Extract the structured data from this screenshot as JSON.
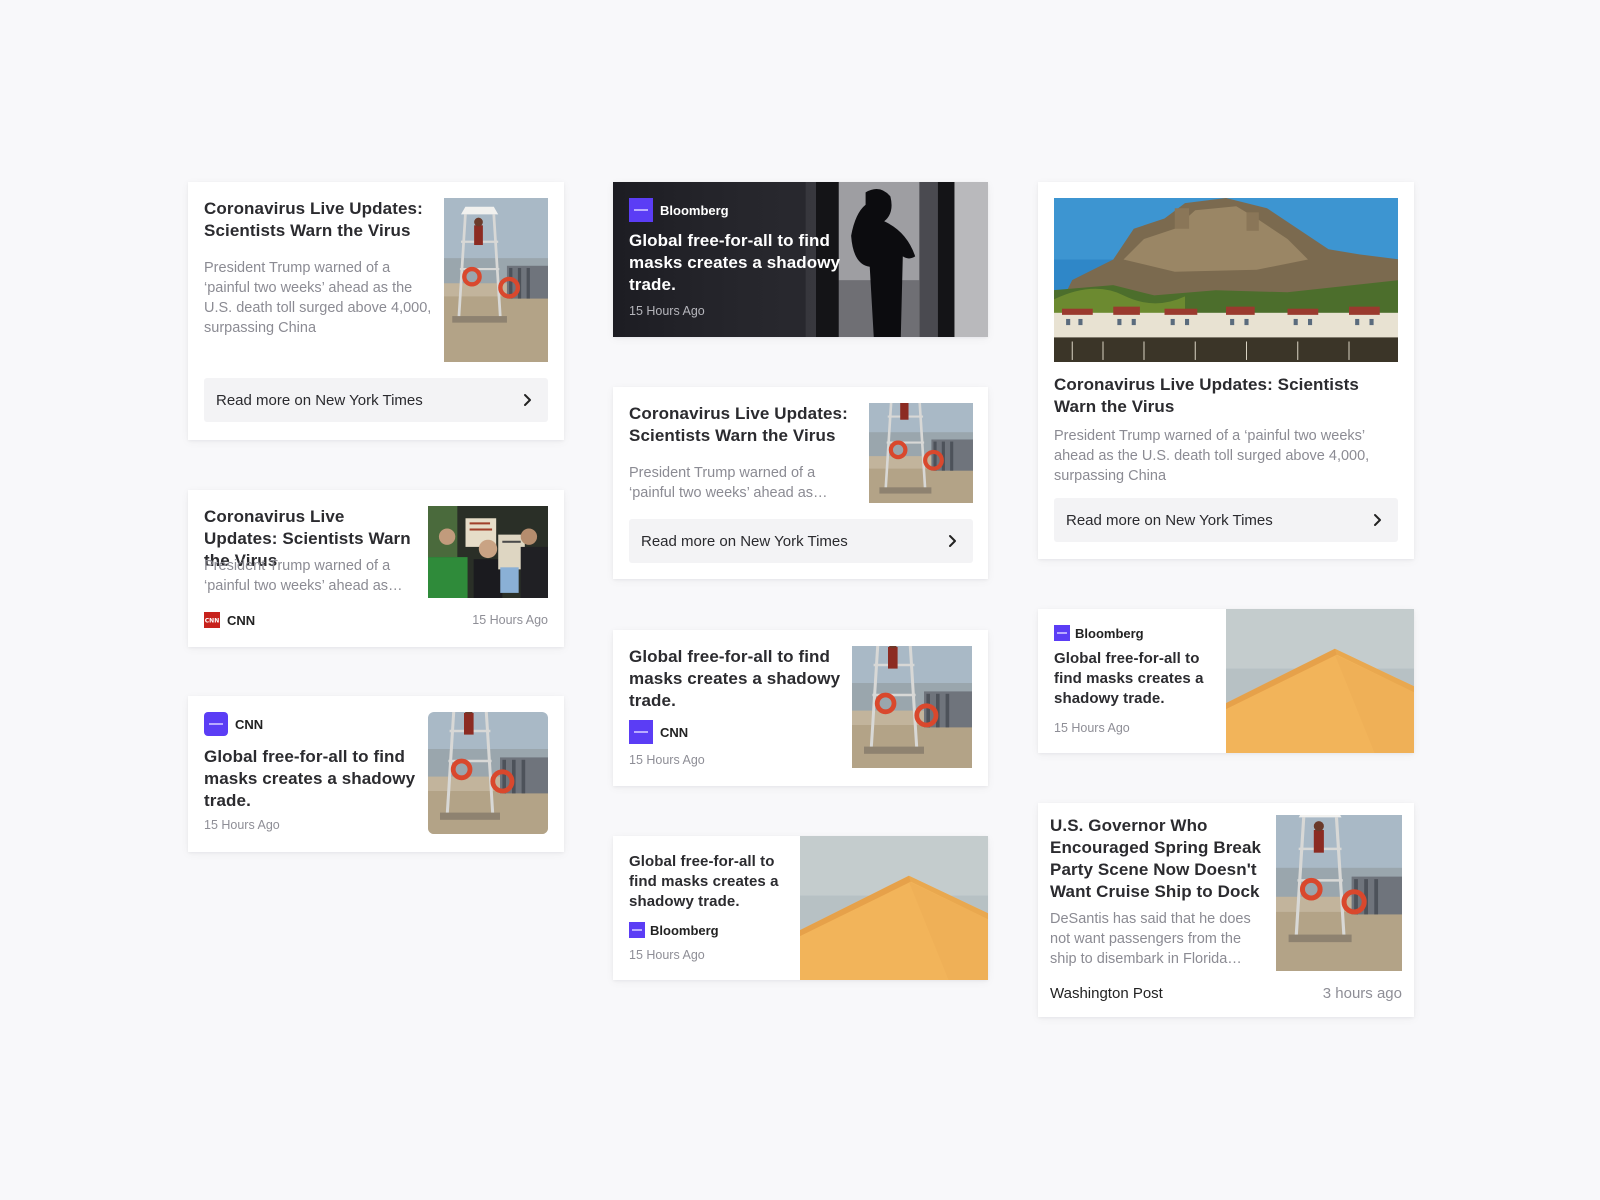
{
  "colors": {
    "bloomberg": "#5b3df5",
    "cnn": "#c7211b",
    "background": "#f8f8fa"
  },
  "cards": {
    "c1": {
      "title": "Coronavirus Live Updates: Scientists Warn the Virus",
      "desc": "President Trump warned of a ‘painful two weeks’ ahead as the U.S. death toll surged above 4,000, surpassing China",
      "readmore": "Read more on New York Times",
      "image": "lifeguard-tower-photo"
    },
    "c2": {
      "title": "Coronavirus Live Updates: Scientists Warn the Virus",
      "desc": "President Trump warned of a ‘painful two weeks’ ahead as…",
      "source": "CNN",
      "time": "15 Hours Ago",
      "image": "protest-photo"
    },
    "c3": {
      "source": "CNN",
      "title": "Global free-for-all to find masks creates a shadowy trade.",
      "time": "15 Hours Ago",
      "image": "lifeguard-tower-photo"
    },
    "c4": {
      "source": "Bloomberg",
      "title": "Global free-for-all to find masks creates a shadowy trade.",
      "time": "15 Hours Ago",
      "image": "silhouette-window-photo"
    },
    "c5": {
      "title": "Coronavirus Live Updates: Scientists Warn the Virus",
      "desc": "President Trump warned of a ‘painful two weeks’ ahead as…",
      "readmore": "Read more on New York Times",
      "image": "lifeguard-tower-photo"
    },
    "c6": {
      "title": "Global free-for-all to find masks creates a shadowy trade.",
      "source": "CNN",
      "time": "15 Hours Ago",
      "image": "lifeguard-tower-photo"
    },
    "c7": {
      "title": "Global free-for-all to find masks creates a shadowy trade.",
      "source": "Bloomberg",
      "time": "15 Hours Ago",
      "image": "yellow-house-photo"
    },
    "c8": {
      "title": "Coronavirus Live Updates: Scientists Warn the Virus",
      "desc": "President Trump warned of a ‘painful two weeks’ ahead as the U.S. death toll surged above 4,000, surpassing China",
      "readmore": "Read more on New York Times",
      "image": "castle-harbor-photo"
    },
    "c9": {
      "source": "Bloomberg",
      "title": "Global free-for-all to find masks creates a shadowy trade.",
      "time": "15 Hours Ago",
      "image": "yellow-house-photo"
    },
    "c10": {
      "title": "U.S. Governor Who Encouraged Spring Break Party Scene Now Doesn't Want Cruise Ship to Dock",
      "desc": "DeSantis has said that he does not want passengers from the ship to disembark in Florida…",
      "source": "Washington Post",
      "time": "3 hours ago",
      "image": "lifeguard-tower-photo"
    }
  }
}
